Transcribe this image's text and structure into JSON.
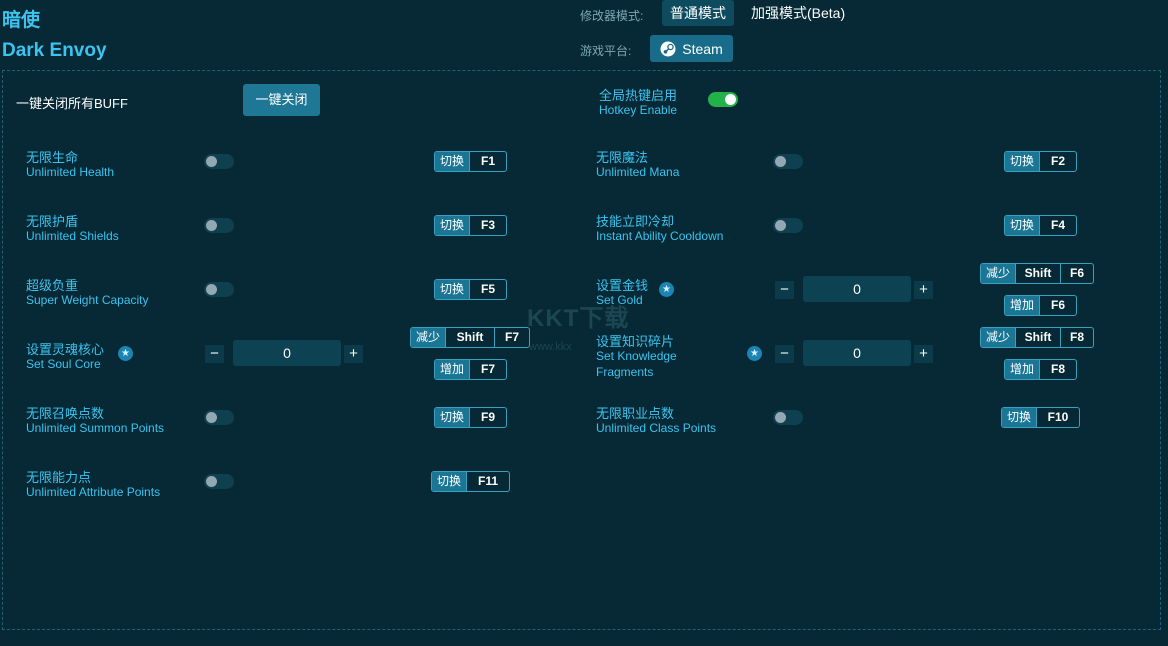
{
  "app": {
    "title_cn": "暗使",
    "title_en": "Dark Envoy"
  },
  "mode": {
    "label": "修改器模式:",
    "normal": "普通模式",
    "boost": "加强模式(Beta)"
  },
  "platform": {
    "label": "游戏平台:",
    "steam": "Steam"
  },
  "global": {
    "close_all_label": "一键关闭所有BUFF",
    "close_all_button": "一键关闭",
    "hotkey_cn": "全局热键启用",
    "hotkey_en": "Hotkey Enable",
    "hotkey_enabled": true
  },
  "watermark": {
    "logo": "KKT下载",
    "url": "www.kkx"
  },
  "actions": {
    "toggle": "切换",
    "decrease": "减少",
    "increase": "增加"
  },
  "keys": {
    "shift": "Shift",
    "f1": "F1",
    "f2": "F2",
    "f3": "F3",
    "f4": "F4",
    "f5": "F5",
    "f6": "F6",
    "f7": "F7",
    "f8": "F8",
    "f9": "F9",
    "f10": "F10",
    "f11": "F11"
  },
  "cheats": [
    {
      "cn": "无限生命",
      "en": "Unlimited Health"
    },
    {
      "cn": "无限魔法",
      "en": "Unlimited Mana"
    },
    {
      "cn": "无限护盾",
      "en": "Unlimited Shields"
    },
    {
      "cn": "技能立即冷却",
      "en": "Instant Ability Cooldown"
    },
    {
      "cn": "超级负重",
      "en": "Super Weight Capacity"
    },
    {
      "cn": "设置金钱",
      "en": "Set Gold",
      "value": "0"
    },
    {
      "cn": "设置灵魂核心",
      "en": "Set Soul Core",
      "value": "0"
    },
    {
      "cn": "设置知识碎片",
      "en": "Set Knowledge",
      "en2": "Fragments",
      "value": "0"
    },
    {
      "cn": "无限召唤点数",
      "en": "Unlimited Summon Points"
    },
    {
      "cn": "无限职业点数",
      "en": "Unlimited Class Points"
    },
    {
      "cn": "无限能力点",
      "en": "Unlimited Attribute Points"
    }
  ],
  "colors": {
    "background": "#062935",
    "accent": "#3cc3f0",
    "toggle_on": "#23b247",
    "button": "#1e7895"
  }
}
